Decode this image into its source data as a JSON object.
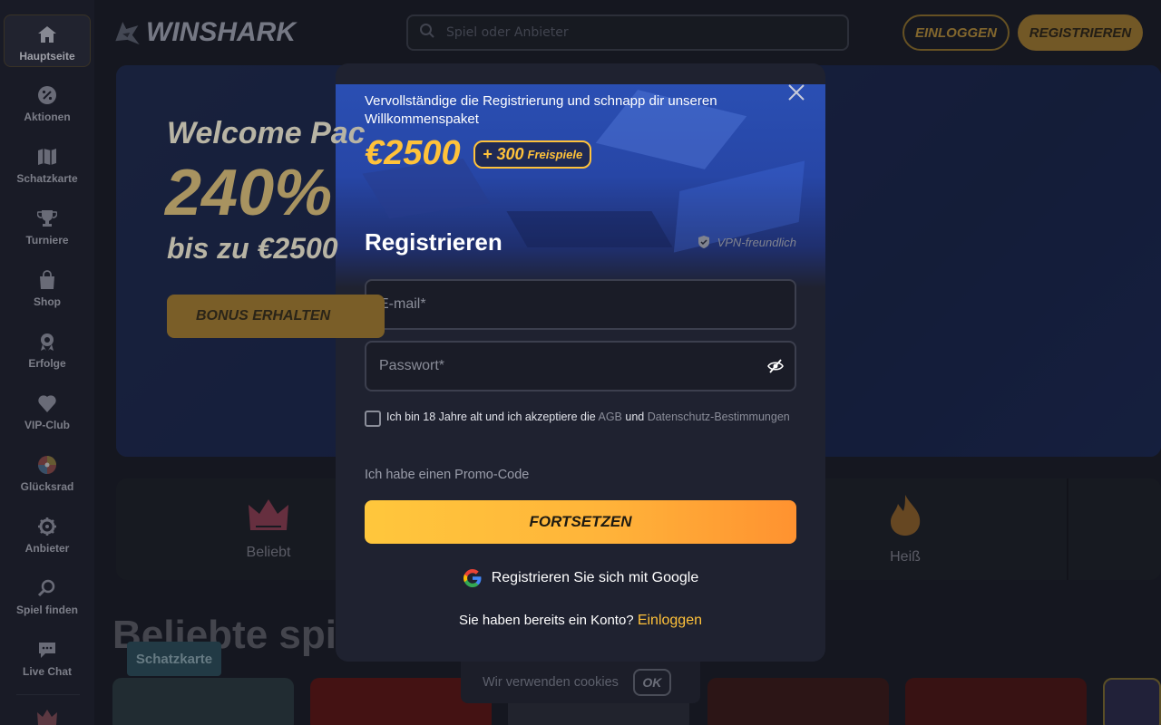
{
  "brand": {
    "logo_text": "WINSHARK"
  },
  "sidebar": {
    "items": [
      {
        "label": "Hauptseite",
        "icon": "home-icon"
      },
      {
        "label": "Aktionen",
        "icon": "percent-icon"
      },
      {
        "label": "Schatzkarte",
        "icon": "map-icon"
      },
      {
        "label": "Turniere",
        "icon": "trophy-icon"
      },
      {
        "label": "Shop",
        "icon": "shop-bag-icon"
      },
      {
        "label": "Erfolge",
        "icon": "medal-icon"
      },
      {
        "label": "VIP-Club",
        "icon": "vip-icon"
      },
      {
        "label": "Glücksrad",
        "icon": "wheel-icon"
      },
      {
        "label": "Anbieter",
        "icon": "gear-icon"
      },
      {
        "label": "Spiel finden",
        "icon": "search-icon"
      },
      {
        "label": "Live Chat",
        "icon": "chat-icon"
      }
    ]
  },
  "header": {
    "search_placeholder": "Spiel oder Anbieter",
    "login_label": "EINLOGGEN",
    "register_label": "REGISTRIEREN"
  },
  "banner": {
    "title": "Welcome Pac",
    "percent": "240%",
    "subtitle": "bis zu €2500",
    "button_label": "BONUS ERHALTEN"
  },
  "categories": [
    {
      "label": "Beliebt",
      "icon": "crown-icon"
    },
    {
      "label": "Heiß",
      "icon": "fire-icon"
    }
  ],
  "section": {
    "title": "Beliebte spie",
    "treasure_tag": "Schatzkarte"
  },
  "modal": {
    "hero_text": "Vervollständige die Registrierung und schnapp dir unseren Willkommenspaket",
    "amount": "€2500",
    "badge_plus": "+ 300",
    "badge_word": "Freispiele",
    "title": "Registrieren",
    "vpn_label": "VPN-freundlich",
    "email_placeholder": "E-mail*",
    "password_placeholder": "Passwort*",
    "consent_prefix": "Ich bin 18 Jahre alt und ich akzeptiere die ",
    "consent_agb": "AGB",
    "consent_and": " und ",
    "consent_privacy": "Datenschutz-Bestimmungen",
    "promo_label": "Ich habe einen Promo-Code",
    "continue_label": "FORTSETZEN",
    "google_label": "Registrieren Sie sich mit Google",
    "account_prompt": "Sie haben bereits ein Konto? ",
    "login_link": "Einloggen"
  },
  "cookie": {
    "text": "Wir verwenden cookies",
    "ok_label": "OK"
  },
  "colors": {
    "accent": "#ffc23a",
    "button_gradient_end": "#ff9230",
    "background": "#1a1d27"
  }
}
